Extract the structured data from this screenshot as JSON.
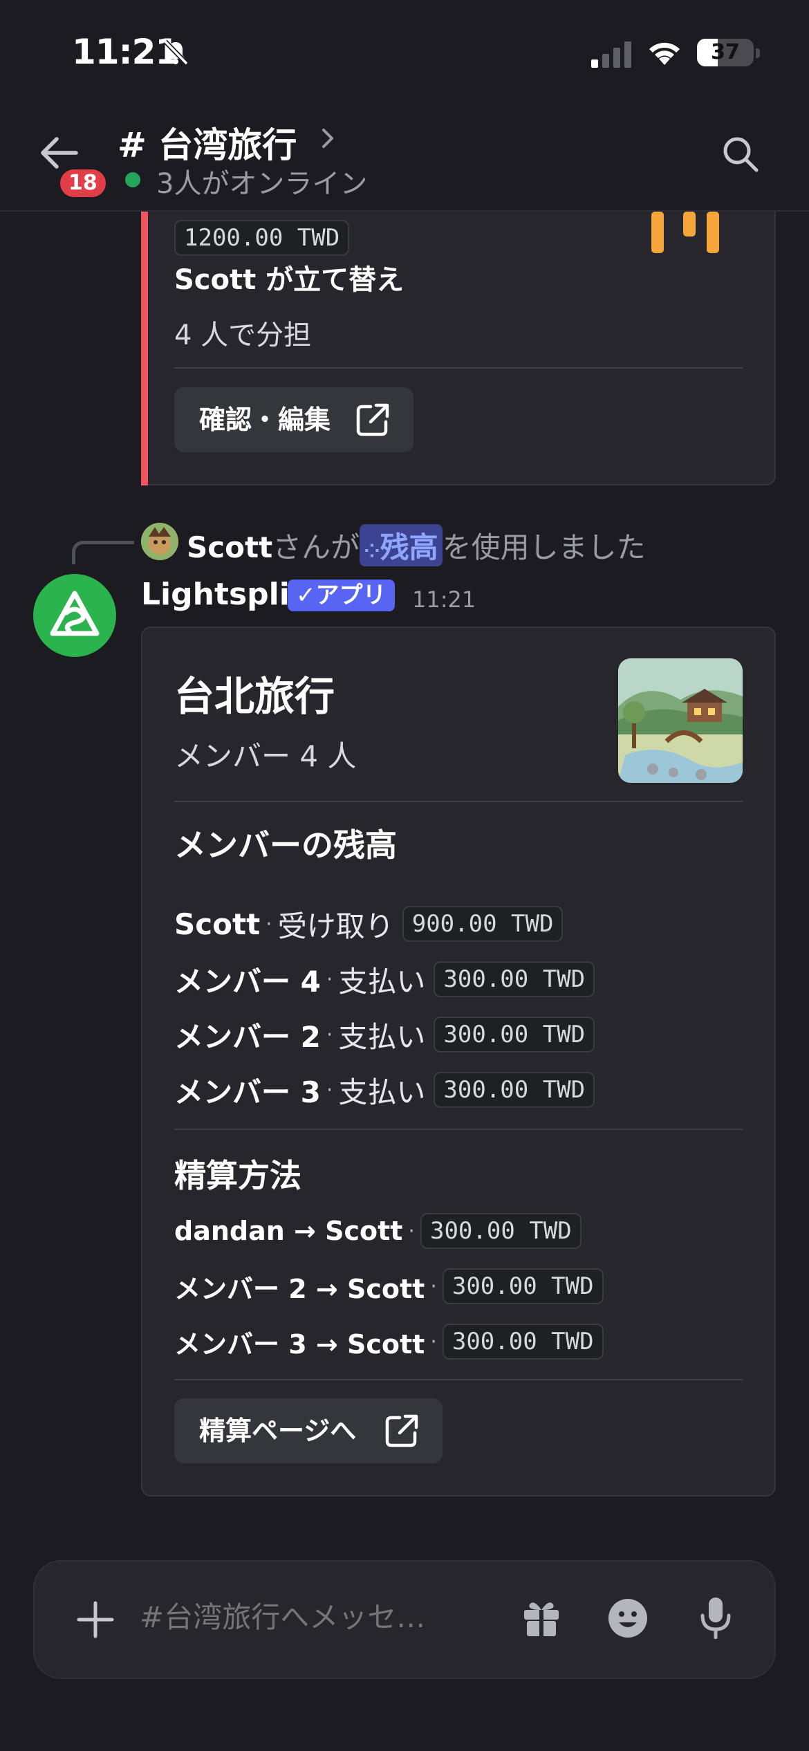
{
  "status_bar": {
    "time": "11:21",
    "battery": "37",
    "battery_level": 0.37
  },
  "header": {
    "unread_count": "18",
    "channel_title": "# 台湾旅行",
    "online": "3人がオンライン"
  },
  "expense_card": {
    "amount": "1200.00 TWD",
    "payer": "Scott が立て替え",
    "split": "4 人で分担",
    "button": "確認・編集"
  },
  "system_message": {
    "user": "Scott",
    "middle": "さんが",
    "command": "残高",
    "suffix": "を使用しました"
  },
  "message": {
    "author": "Lightsplit",
    "app_tag": "アプリ",
    "time": "11:21"
  },
  "trip_card": {
    "title": "台北旅行",
    "members": "メンバー 4 人",
    "balances_heading": "メンバーの残高",
    "balances": [
      {
        "name": "Scott",
        "status": "受け取り",
        "amount": "900.00 TWD"
      },
      {
        "name": "メンバー 4",
        "status": "支払い",
        "amount": "300.00 TWD"
      },
      {
        "name": "メンバー 2",
        "status": "支払い",
        "amount": "300.00 TWD"
      },
      {
        "name": "メンバー 3",
        "status": "支払い",
        "amount": "300.00 TWD"
      }
    ],
    "settle_heading": "精算方法",
    "settlements": [
      {
        "route": "dandan → Scott",
        "amount": "300.00 TWD"
      },
      {
        "route": "メンバー 2 → Scott",
        "amount": "300.00 TWD"
      },
      {
        "route": "メンバー 3 → Scott",
        "amount": "300.00 TWD"
      }
    ],
    "button": "精算ページへ"
  },
  "composer": {
    "placeholder": "#台湾旅行へメッセ…"
  },
  "colors": {
    "accent_bar": "#f0565f",
    "app_tag": "#5865f2",
    "online": "#23a55a",
    "badge": "#e23e48",
    "bot_avatar": "#2bb34e"
  }
}
